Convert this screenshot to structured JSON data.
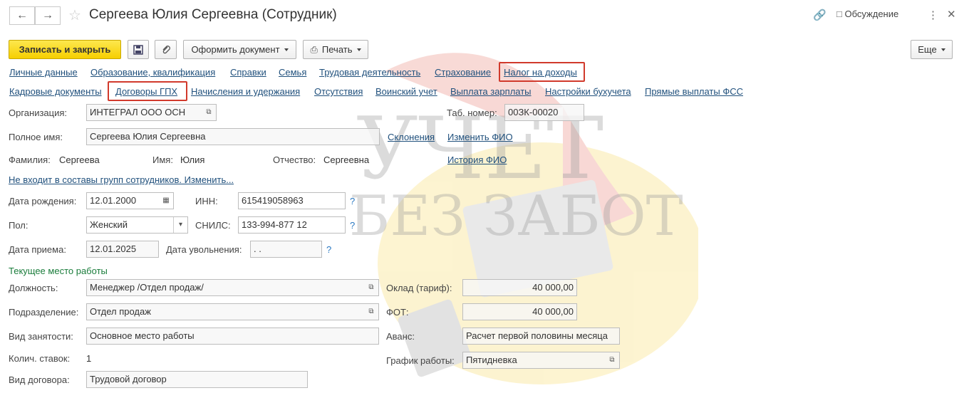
{
  "window": {
    "title": "Сергеева Юлия Сергеевна (Сотрудник)",
    "back_icon": "arrow-left-icon",
    "forward_icon": "arrow-right-icon",
    "favorite_icon": "star-icon",
    "link_icon": "link-icon",
    "discussion_label": "Обсуждение",
    "more_icon": "more-vertical-icon",
    "close_icon": "close-icon"
  },
  "toolbar": {
    "save_close_label": "Записать и закрыть",
    "save_icon": "floppy-icon",
    "attach_icon": "paperclip-icon",
    "issue_doc_label": "Оформить документ",
    "print_label": "Печать",
    "more_label": "Еще"
  },
  "links_row1": [
    "Личные данные",
    "Образование, квалификация",
    "Справки",
    "Семья",
    "Трудовая деятельность",
    "Страхование",
    "Налог на доходы"
  ],
  "links_row2": [
    "Кадровые документы",
    "Договоры ГПХ",
    "Начисления и удержания",
    "Отсутствия",
    "Воинский учет",
    "Выплата зарплаты",
    "Настройки бухучета",
    "Прямые выплаты ФСС"
  ],
  "form": {
    "org_label": "Организация:",
    "org_value": "ИНТЕГРАЛ ООО ОСН",
    "tab_label": "Таб. номер:",
    "tab_value": "00ЗК-00020",
    "fullname_label": "Полное имя:",
    "fullname_value": "Сергеева Юлия Сергеевна",
    "declension_link": "Склонения",
    "change_fio_link": "Изменить ФИО",
    "surname_label": "Фамилия:",
    "surname_value": "Сергеева",
    "name_label": "Имя:",
    "name_value": "Юлия",
    "patronymic_label": "Отчество:",
    "patronymic_value": "Сергеевна",
    "fio_history_link": "История ФИО",
    "groups_link": "Не входит в составы групп сотрудников. Изменить...",
    "birth_label": "Дата рождения:",
    "birth_value": "12.01.2000",
    "inn_label": "ИНН:",
    "inn_value": "615419058963",
    "gender_label": "Пол:",
    "gender_value": "Женский",
    "snils_label": "СНИЛС:",
    "snils_value": "133-994-877 12",
    "hire_label": "Дата приема:",
    "hire_value": "12.01.2025",
    "fire_label": "Дата увольнения:",
    "fire_value": " .  .",
    "help_mark": "?",
    "workplace_header": "Текущее место работы",
    "position_label": "Должность:",
    "position_value": "Менеджер /Отдел продаж/",
    "salary_label": "Оклад (тариф):",
    "salary_value": "40 000,00",
    "dept_label": "Подразделение:",
    "dept_value": "Отдел продаж",
    "fot_label": "ФОТ:",
    "fot_value": "40 000,00",
    "employment_label": "Вид занятости:",
    "employment_value": "Основное место работы",
    "advance_label": "Аванс:",
    "advance_value": "Расчет первой половины месяца",
    "rates_label": "Колич. ставок:",
    "rates_value": "1",
    "schedule_label": "График работы:",
    "schedule_value": "Пятидневка",
    "contract_label": "Вид договора:",
    "contract_value": "Трудовой договор"
  },
  "watermark": {
    "line1": "УЧЕТ",
    "line2": "БЕЗ ЗАБОТ"
  }
}
